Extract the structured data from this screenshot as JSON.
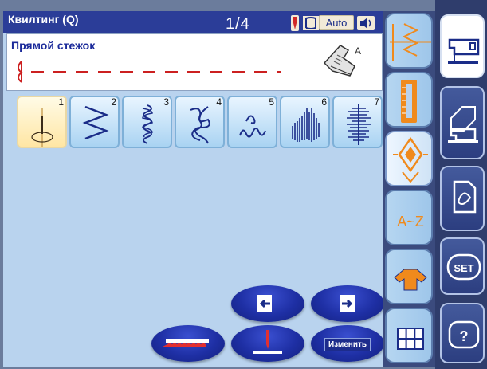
{
  "header": {
    "title": "Квилтинг (Q)",
    "page_indicator": "1/4",
    "auto_label": "Auto",
    "status_icons": [
      "needle-position-icon",
      "presser-foot-icon",
      "speaker-icon"
    ]
  },
  "stitch_info": {
    "name": "Прямой стежок",
    "foot_letter": "A"
  },
  "patterns": [
    {
      "num": "1",
      "icon": "straight-stitch-icon",
      "selected": true
    },
    {
      "num": "2",
      "icon": "zigzag-stitch-icon",
      "selected": false
    },
    {
      "num": "3",
      "icon": "stipple-stitch-icon",
      "selected": false
    },
    {
      "num": "4",
      "icon": "meander-stitch-icon",
      "selected": false
    },
    {
      "num": "5",
      "icon": "loop-stitch-icon",
      "selected": false
    },
    {
      "num": "6",
      "icon": "satin-wave-stitch-icon",
      "selected": false
    },
    {
      "num": "7",
      "icon": "satin-column-stitch-icon",
      "selected": false
    }
  ],
  "controls": {
    "prev_page_icon": "arrow-left-icon",
    "next_page_icon": "arrow-right-icon",
    "feed_dog_icon": "feed-dog-icon",
    "needle_icon": "needle-icon",
    "edit_label": "Изменить"
  },
  "category_tabs": [
    "utility-stitch-icon",
    "buttonhole-icon",
    "decorative-stitch-icon",
    "alphabet-icon",
    "applique-garment-icon",
    "quilt-grid-icon"
  ],
  "alphabet_tab_label": "A~Z",
  "side_buttons": {
    "set_label": "SET",
    "help_label": "?"
  },
  "colors": {
    "lcd_bg": "#b9d3ee",
    "title_bar": "#2b3d98",
    "accent_orange": "#f08a1c",
    "stitch_red": "#cc2020"
  }
}
